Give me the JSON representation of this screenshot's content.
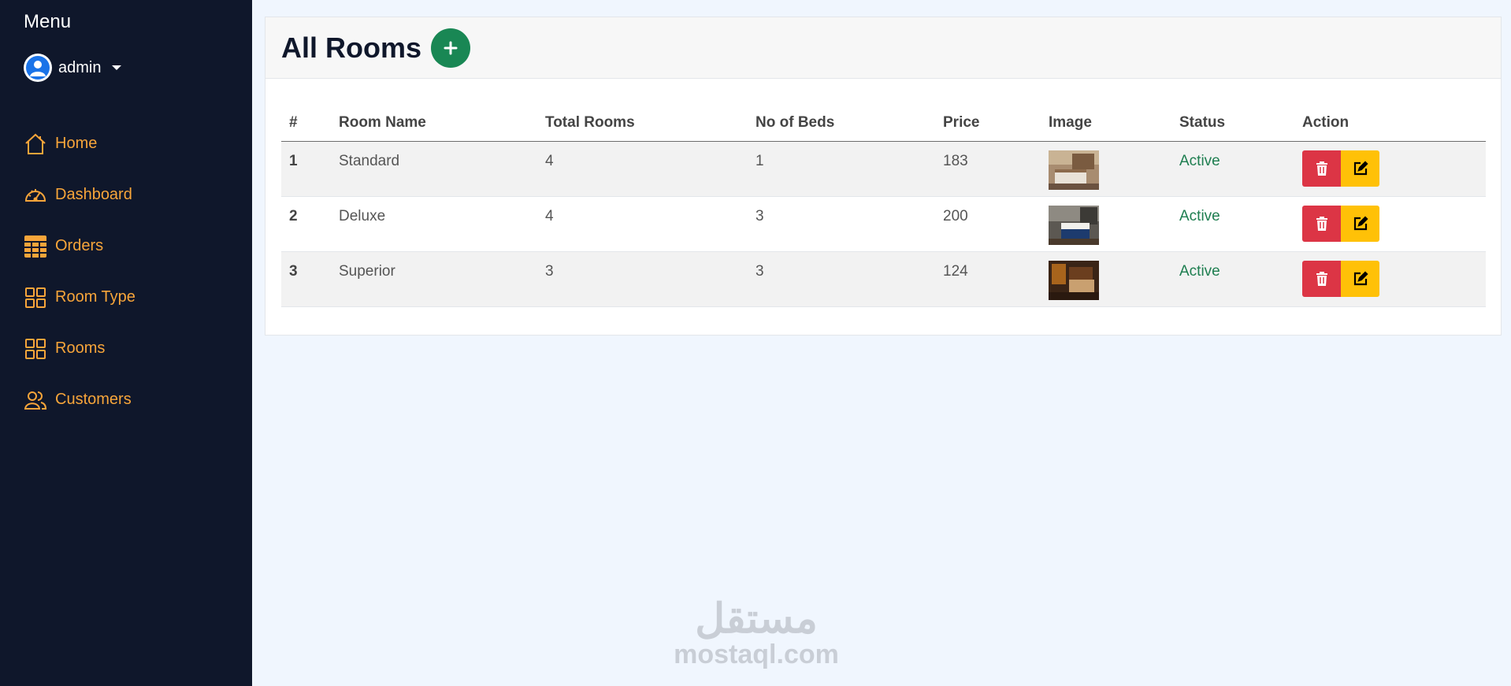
{
  "sidebar": {
    "title": "Menu",
    "user": {
      "name": "admin",
      "icon": "user-circle-icon"
    },
    "items": [
      {
        "label": "Home",
        "icon": "house-icon"
      },
      {
        "label": "Dashboard",
        "icon": "speedometer-icon"
      },
      {
        "label": "Orders",
        "icon": "table-icon"
      },
      {
        "label": "Room Type",
        "icon": "grid-icon"
      },
      {
        "label": "Rooms",
        "icon": "grid-icon"
      },
      {
        "label": "Customers",
        "icon": "people-icon"
      }
    ]
  },
  "main": {
    "title": "All Rooms",
    "add_icon": "plus-icon",
    "table": {
      "headers": [
        "#",
        "Room Name",
        "Total Rooms",
        "No of Beds",
        "Price",
        "Image",
        "Status",
        "Action"
      ],
      "rows": [
        {
          "id": "1",
          "name": "Standard",
          "total": "4",
          "beds": "1",
          "price": "183",
          "status": "Active"
        },
        {
          "id": "2",
          "name": "Deluxe",
          "total": "4",
          "beds": "3",
          "price": "200",
          "status": "Active"
        },
        {
          "id": "3",
          "name": "Superior",
          "total": "3",
          "beds": "3",
          "price": "124",
          "status": "Active"
        }
      ]
    }
  },
  "watermark": {
    "arabic": "مستقل",
    "latin": "mostaql.com"
  },
  "colors": {
    "sidebar_bg": "#0f172b",
    "nav_accent": "#f7a53a",
    "add_button": "#198754",
    "delete_button": "#dc3545",
    "edit_button": "#ffc107",
    "status_active": "#1e7e50"
  }
}
